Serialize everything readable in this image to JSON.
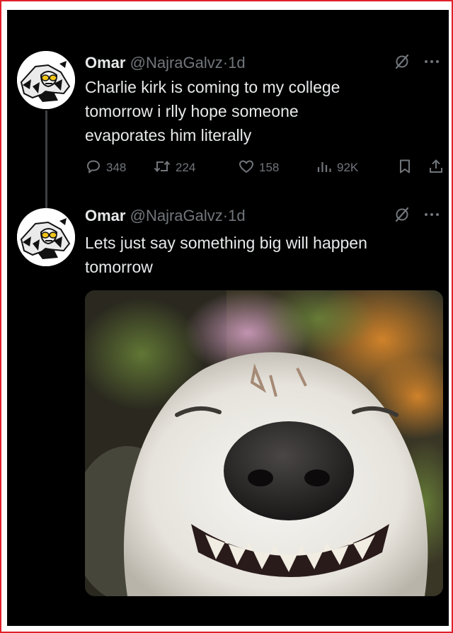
{
  "tweets": [
    {
      "name": "Omar",
      "handle": "@NajraGalvz",
      "separator": "·",
      "time": "1d",
      "text_lines": [
        "Charlie kirk is coming to my college",
        "tomorrow i rlly hope someone",
        "evaporates him literally"
      ],
      "stats": {
        "replies": "348",
        "retweets": "224",
        "likes": "158",
        "views": "92K"
      }
    },
    {
      "name": "Omar",
      "handle": "@NajraGalvz",
      "separator": "·",
      "time": "1d",
      "text_lines": [
        "Lets just say something big will happen",
        "tomorrow"
      ]
    }
  ],
  "icons": {
    "reply": "comment-icon",
    "retweet": "retweet-icon",
    "like": "heart-icon",
    "views": "views-icon",
    "bookmark": "bookmark-icon",
    "share": "share-icon",
    "grok": "grok-icon",
    "more": "more-icon"
  },
  "colors": {
    "background": "#000000",
    "text": "#e7e9ea",
    "muted": "#71767b",
    "frame_border": "#e0202a"
  }
}
